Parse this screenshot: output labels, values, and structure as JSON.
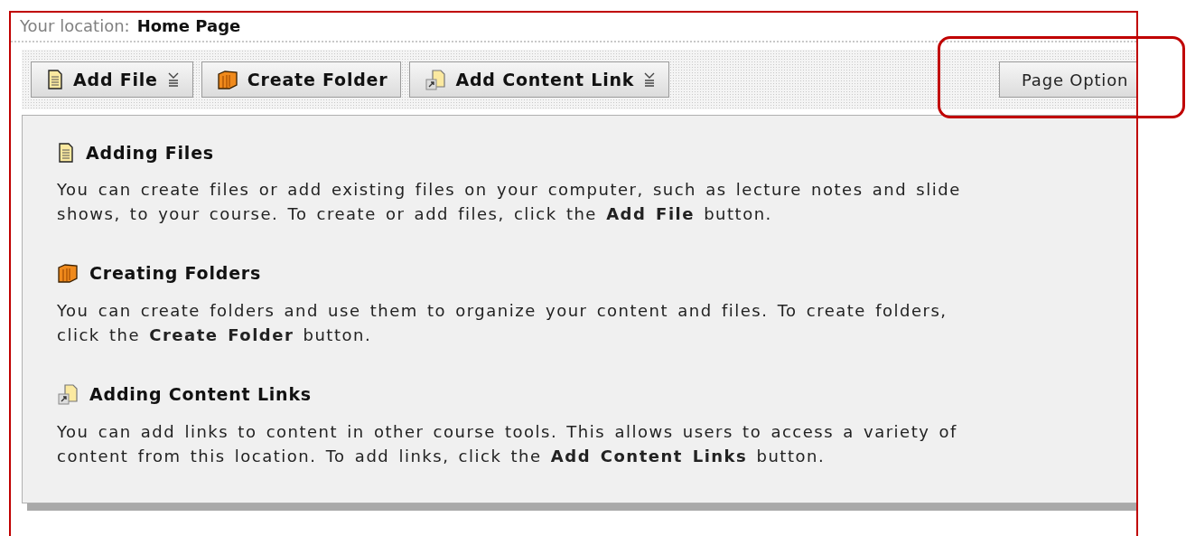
{
  "location": {
    "label": "Your location:",
    "page": "Home Page"
  },
  "toolbar": {
    "buttons": [
      {
        "label": "Add File",
        "kind": "file",
        "dropdown": true
      },
      {
        "label": "Create Folder",
        "kind": "folder",
        "dropdown": false
      },
      {
        "label": "Add Content Link",
        "kind": "link",
        "dropdown": true
      }
    ],
    "page_options": {
      "label": "Page Option"
    }
  },
  "sections": [
    {
      "kind": "file",
      "title": "Adding Files",
      "text": "You can create files or add existing files on your computer, such as lecture notes and slide shows, to your course. To create or add files, click the **Add File** button."
    },
    {
      "kind": "folder",
      "title": "Creating Folders",
      "text": "You can create folders and use them to organize your content and files. To create folders, click the **Create Folder** button."
    },
    {
      "kind": "link",
      "title": "Adding Content Links",
      "text": "You can add links to content in other course tools. This allows users to access a variety of content from this location. To add links, click the **Add Content Links** button."
    }
  ]
}
